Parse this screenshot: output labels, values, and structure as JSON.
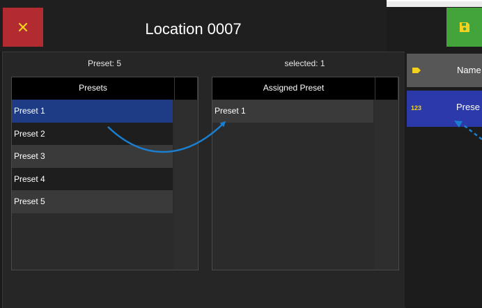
{
  "title": "Location 0007",
  "header": {
    "preset_count": "Preset: 5",
    "selected_count": "selected: 1"
  },
  "presets": {
    "column_header": "Presets",
    "items": [
      "Preset 1",
      "Preset 2",
      "Preset 3",
      "Preset 4",
      "Preset 5"
    ],
    "selected_index": 0
  },
  "assigned": {
    "column_header": "Assigned Preset",
    "items": [
      "Preset 1"
    ]
  },
  "side": {
    "name_label": "Name",
    "preset_label": "Prese",
    "number_icon_text": "123"
  },
  "colors": {
    "close": "#b12b30",
    "save": "#44a43c",
    "selected_row": "#1e3c86",
    "side_selected": "#2b3aa8",
    "arrow": "#1a7fd0",
    "tag": "#f4d21f"
  },
  "icons": {
    "close": "close-icon",
    "save": "save-icon",
    "tag": "tag-icon",
    "number": "number-icon"
  }
}
